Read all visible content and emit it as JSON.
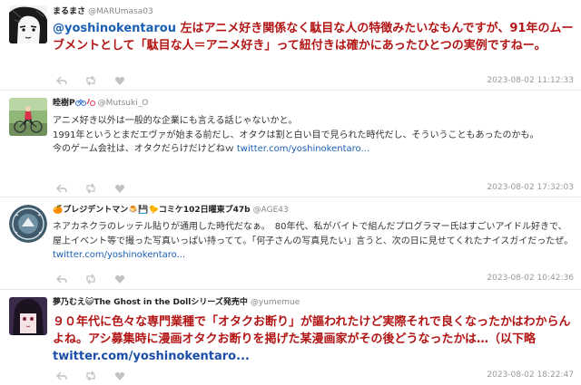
{
  "tweets": [
    {
      "user_name": "まるまさ",
      "user_handle": "@MARUmasa03",
      "mention": "@yoshinokentarou",
      "text": " 左はアニメ好き関係なく駄目な人の特徴みたいなもんですが、91年のムーブメントとして「駄目な人＝アニメ好き」って紐付きは確かにあったひとつの実例ですねー。",
      "timestamp": "2023-08-02 11:12:33",
      "avatar_icon": "manga-character-avatar"
    },
    {
      "user_name": "睦樹P",
      "user_badges": "🚲♂🚲",
      "user_handle": "@Mutsuki_O",
      "line1": "アニメ好き以外は一般的な企業にも言える話じゃないかと。",
      "line2": "1991年というとまだエヴァが始まる前だし、オタクは割と白い目で見られた時代だし、そういうこともあったのかも。",
      "line3": "今のゲーム会社は、オタクだらけだけどねｗ",
      "link": "twitter.com/yoshinokentaro...",
      "timestamp": "2023-08-02 17:32:03",
      "avatar_icon": "cyclist-photo-avatar"
    },
    {
      "user_name": "🍊プレジデントマン🍮💾🐤コミケ102日曜東プ47b",
      "user_handle": "@AGE43",
      "text": "ネアカネクラのレッテル貼りが通用した時代だなぁ。　80年代、私がバイトで組んだプログラマー氏はすごいアイドル好きで、屋上イベント等で撮った写真いっぱい持ってて。「何子さんの写真見たい」言うと、次の日に見せてくれたナイスガイだったぜ。 ",
      "link": "twitter.com/yoshinokentaro...",
      "timestamp": "2023-08-02 10:42:36",
      "avatar_icon": "circular-logo-avatar"
    },
    {
      "user_name": "夢乃むえ😺The Ghost in the Dollシリーズ発売中",
      "user_handle": "@yumemue",
      "text": "９０年代に色々な専門業種で「オタクお断り」が謳われたけど実際それで良くなったかはわからんよね。アシ募集時に漫画オタクお断りを掲げた某漫画家がその後どうなったかは…（以下略 ",
      "link": "twitter.com/yoshinokentaro...",
      "timestamp": "2023-08-02 18:22:47",
      "avatar_icon": "anime-girl-avatar"
    }
  ],
  "action_icons": [
    "reply-icon",
    "retweet-icon",
    "like-icon"
  ],
  "colors": {
    "emphasis_red": "#b31515",
    "link_blue": "#1a5fb4",
    "meta_gray": "#999999"
  }
}
